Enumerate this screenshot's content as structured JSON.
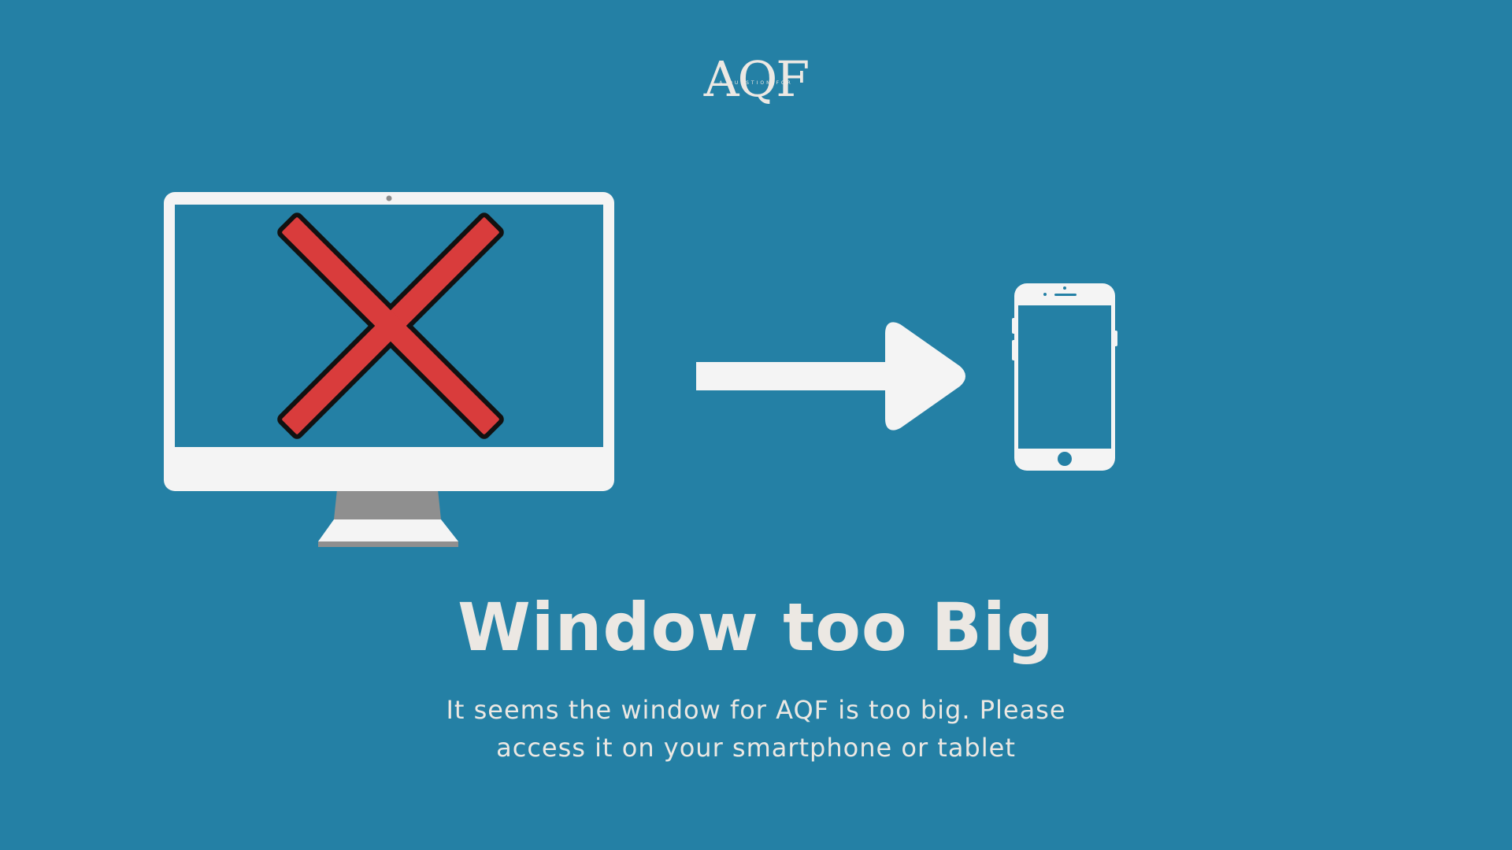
{
  "logo": {
    "letters": "AQF",
    "tagline": "A QUESTION FOR"
  },
  "illustration": {
    "desktop": "desktop-monitor-icon",
    "cross": "cross-icon",
    "arrow": "arrow-right-icon",
    "phone": "smartphone-icon",
    "colors": {
      "background": "#2480a5",
      "device": "#f4f4f4",
      "stand": "#8c8c8c",
      "cross": "#d93c3c"
    }
  },
  "message": {
    "title": "Window too Big",
    "body": "It seems the window for AQF is too big. Please access it on your smartphone or tablet"
  }
}
